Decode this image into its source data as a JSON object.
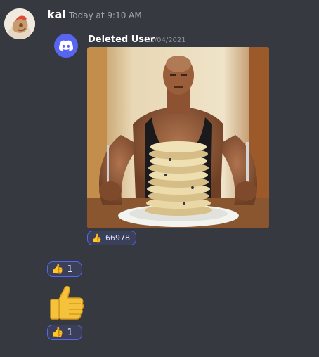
{
  "message": {
    "username": "kal",
    "timestamp": "Today at 9:10 AM"
  },
  "embed": {
    "author": "Deleted User",
    "date": "11/04/2021"
  },
  "reactions": {
    "embed_reaction": {
      "emoji": "👍",
      "count": "66978"
    },
    "first_reaction": {
      "emoji": "👍",
      "count": "1"
    },
    "second_reaction": {
      "emoji": "👍",
      "count": "1"
    }
  },
  "colors": {
    "background": "#36393f",
    "brand": "#5865f2",
    "reaction_bg": "#3b405a",
    "thumb": "#f5c33b"
  }
}
